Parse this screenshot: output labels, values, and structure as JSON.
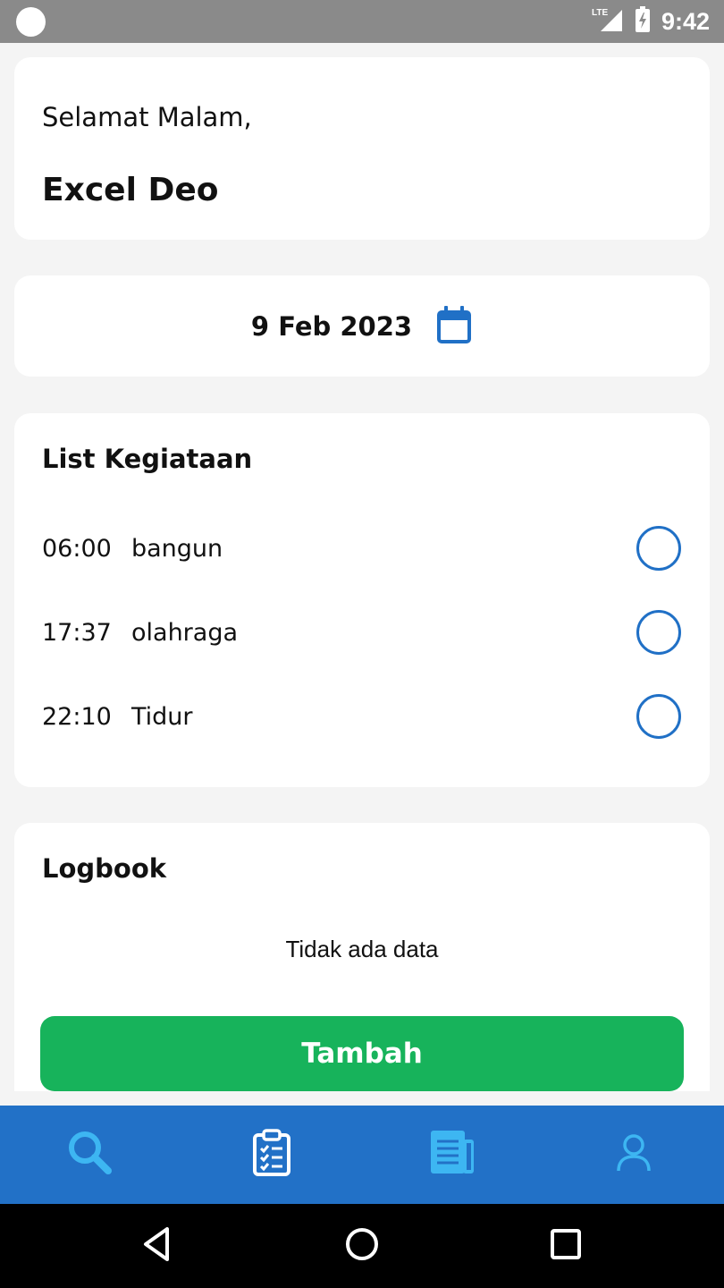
{
  "status_bar": {
    "network": "LTE",
    "time": "9:42"
  },
  "greeting": {
    "salutation": "Selamat Malam,",
    "name": "Excel Deo"
  },
  "date_picker": {
    "date": "9 Feb 2023",
    "icon": "calendar-icon"
  },
  "activity_list": {
    "title": "List Kegiataan",
    "items": [
      {
        "time": "06:00",
        "name": "bangun",
        "done": false
      },
      {
        "time": "17:37",
        "name": "olahraga",
        "done": false
      },
      {
        "time": "22:10",
        "name": "Tidur",
        "done": false
      }
    ]
  },
  "logbook": {
    "title": "Logbook",
    "empty_text": "Tidak ada data",
    "add_label": "Tambah"
  },
  "bottom_nav": {
    "items": [
      {
        "icon": "search-icon",
        "active": true
      },
      {
        "icon": "clipboard-checklist-icon",
        "active": false
      },
      {
        "icon": "newspaper-icon",
        "active": false
      },
      {
        "icon": "person-icon",
        "active": false
      }
    ]
  },
  "colors": {
    "accent": "#2070c6",
    "nav_bg": "#2271c7",
    "nav_icon": "#3db6f2",
    "button_green": "#17b35b",
    "background": "#f4f4f4"
  }
}
